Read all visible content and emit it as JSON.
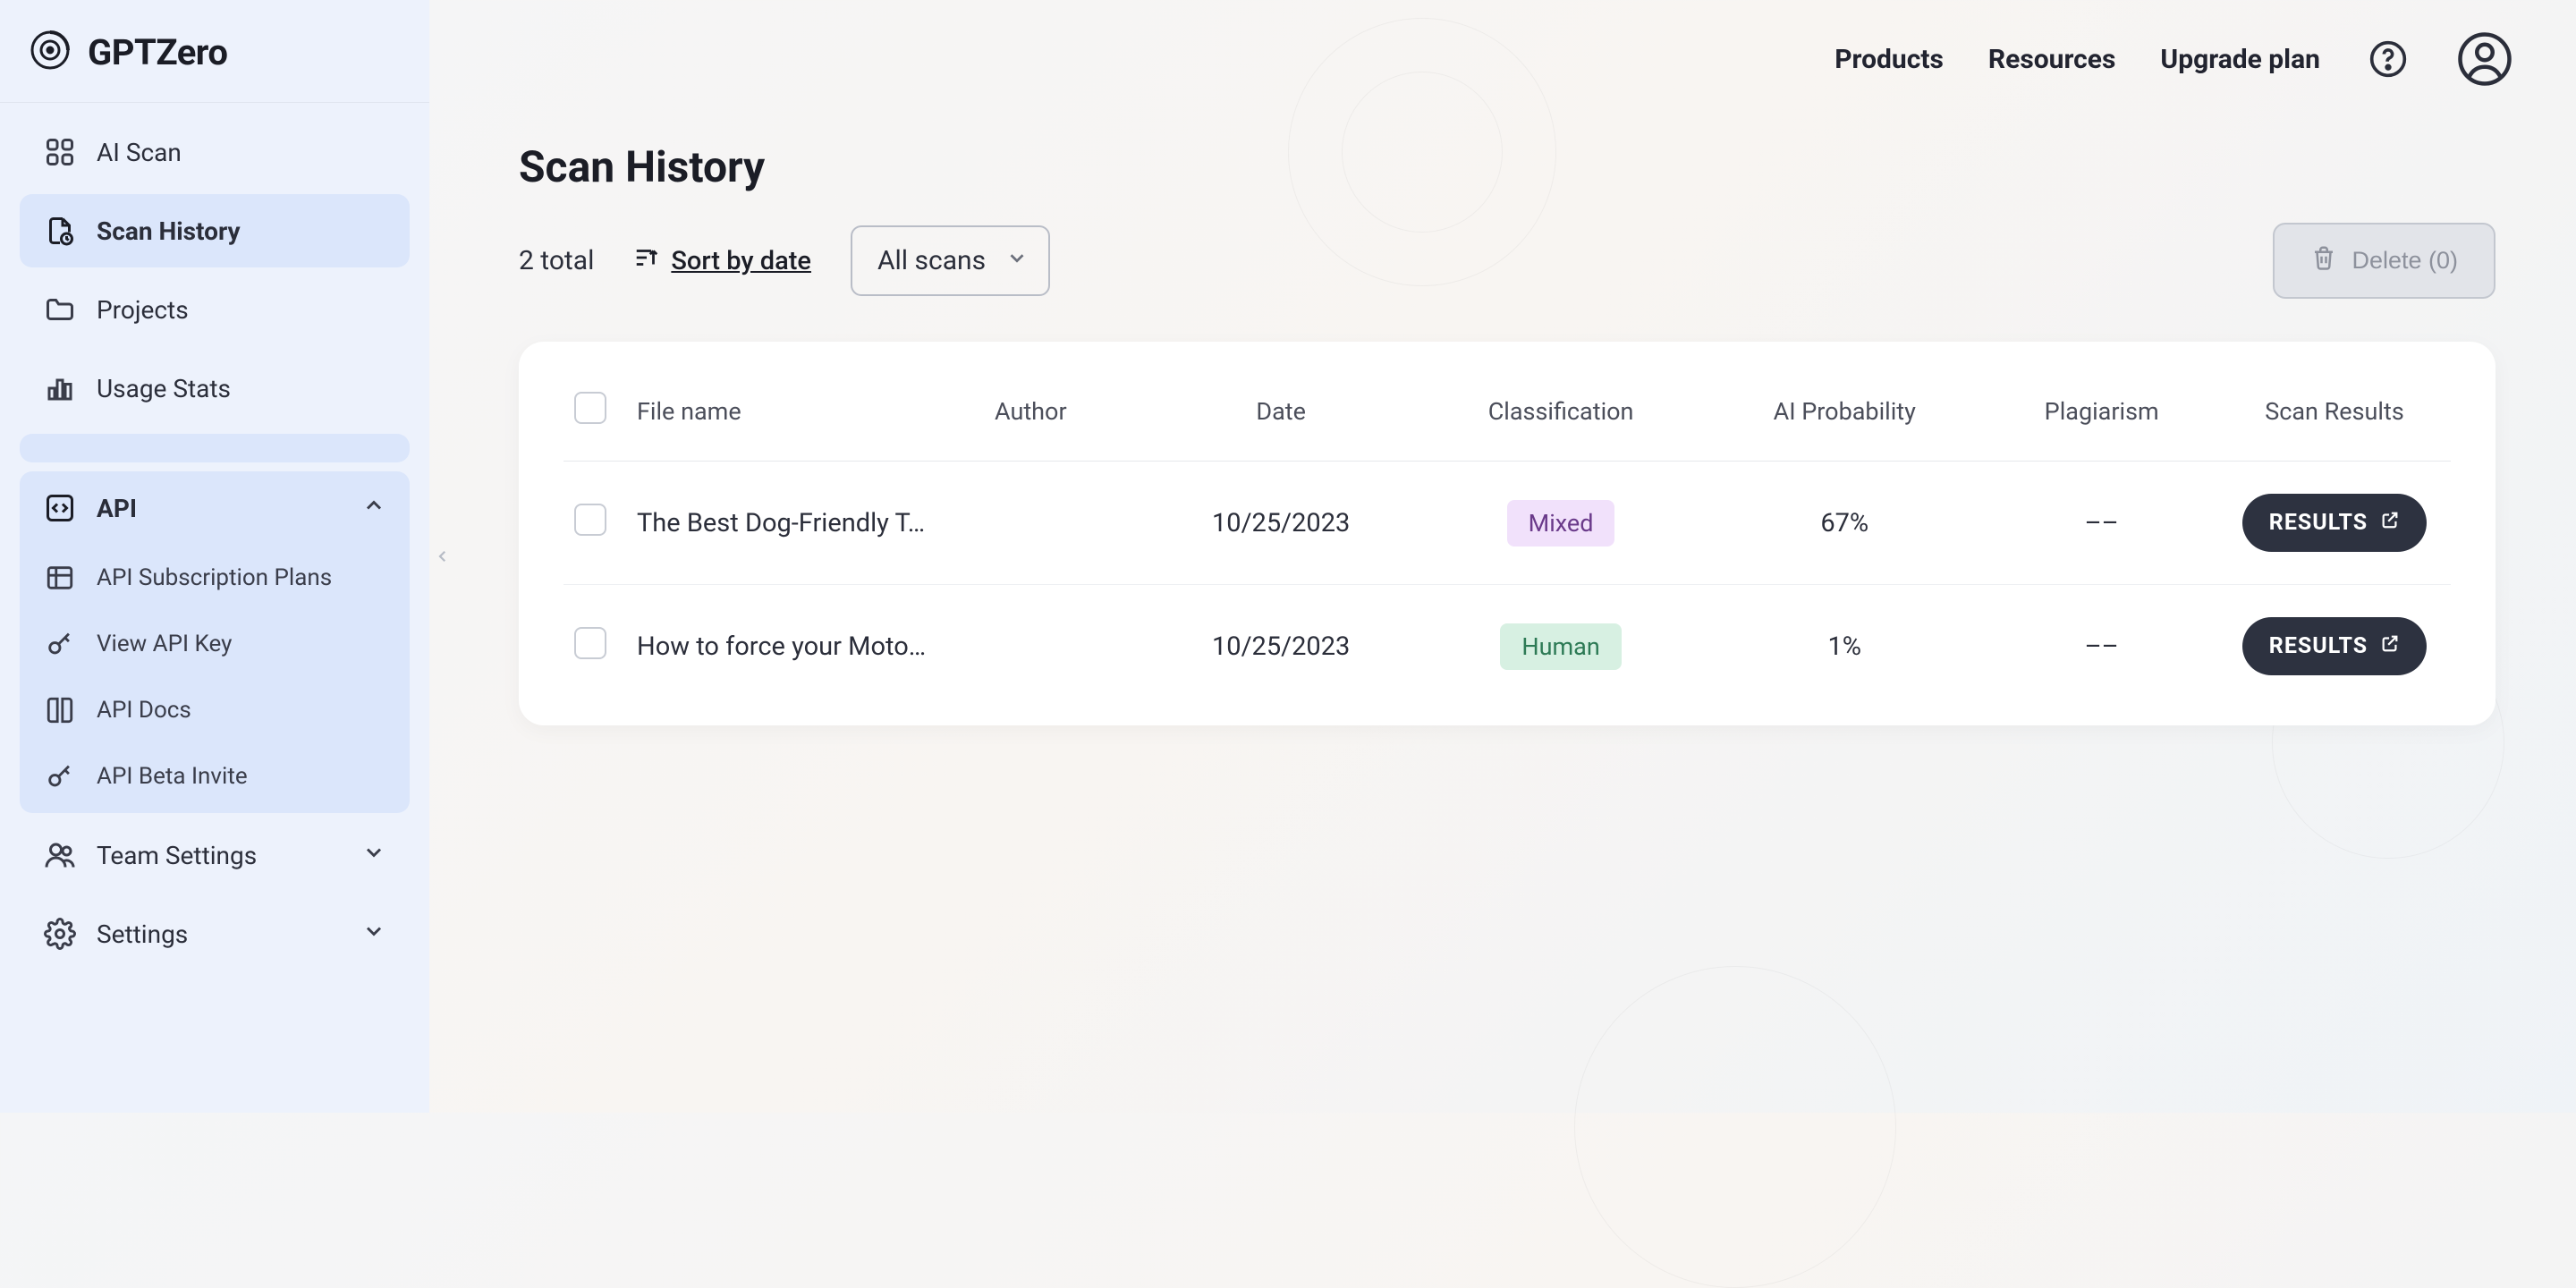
{
  "brand": "GPTZero",
  "topnav": {
    "products": "Products",
    "resources": "Resources",
    "upgrade": "Upgrade plan"
  },
  "sidebar": {
    "ai_scan": "AI Scan",
    "scan_history": "Scan History",
    "projects": "Projects",
    "usage_stats": "Usage Stats",
    "api": "API",
    "api_sub_plans": "API Subscription Plans",
    "view_api_key": "View API Key",
    "api_docs": "API Docs",
    "api_beta_invite": "API Beta Invite",
    "team_settings": "Team Settings",
    "settings": "Settings"
  },
  "page": {
    "title": "Scan History",
    "total": "2 total",
    "sort_label": "Sort by date",
    "filter_selected": "All scans",
    "delete_label": "Delete (0)"
  },
  "table": {
    "headers": {
      "file_name": "File name",
      "author": "Author",
      "date": "Date",
      "classification": "Classification",
      "ai_probability": "AI Probability",
      "plagiarism": "Plagiarism",
      "scan_results": "Scan Results"
    },
    "rows": [
      {
        "file_name": "The Best Dog-Friendly T…",
        "author": "",
        "date": "10/25/2023",
        "classification": "Mixed",
        "classification_kind": "mixed",
        "ai_probability": "67%",
        "plagiarism": "––",
        "results_label": "RESULTS"
      },
      {
        "file_name": "How to force your Moto…",
        "author": "",
        "date": "10/25/2023",
        "classification": "Human",
        "classification_kind": "human",
        "ai_probability": "1%",
        "plagiarism": "––",
        "results_label": "RESULTS"
      }
    ]
  }
}
